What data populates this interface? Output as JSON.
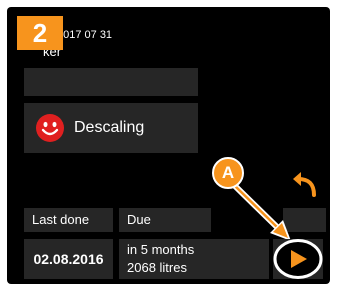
{
  "step_badge": "2",
  "header": {
    "date": "2017 07 31",
    "name": "ker"
  },
  "feature": {
    "label": "Descaling",
    "icon": "smiley-face-icon",
    "icon_color": "#e02020"
  },
  "columns": {
    "last_done_label": "Last done",
    "due_label": "Due"
  },
  "values": {
    "last_done_date": "02.08.2016",
    "due_line1": "in 5 months",
    "due_line2": "2068 litres"
  },
  "callout": {
    "letter": "A",
    "color": "#f7941d"
  },
  "buttons": {
    "back_icon": "back-arrow-icon",
    "play_icon": "play-icon",
    "accent": "#f7941d"
  }
}
